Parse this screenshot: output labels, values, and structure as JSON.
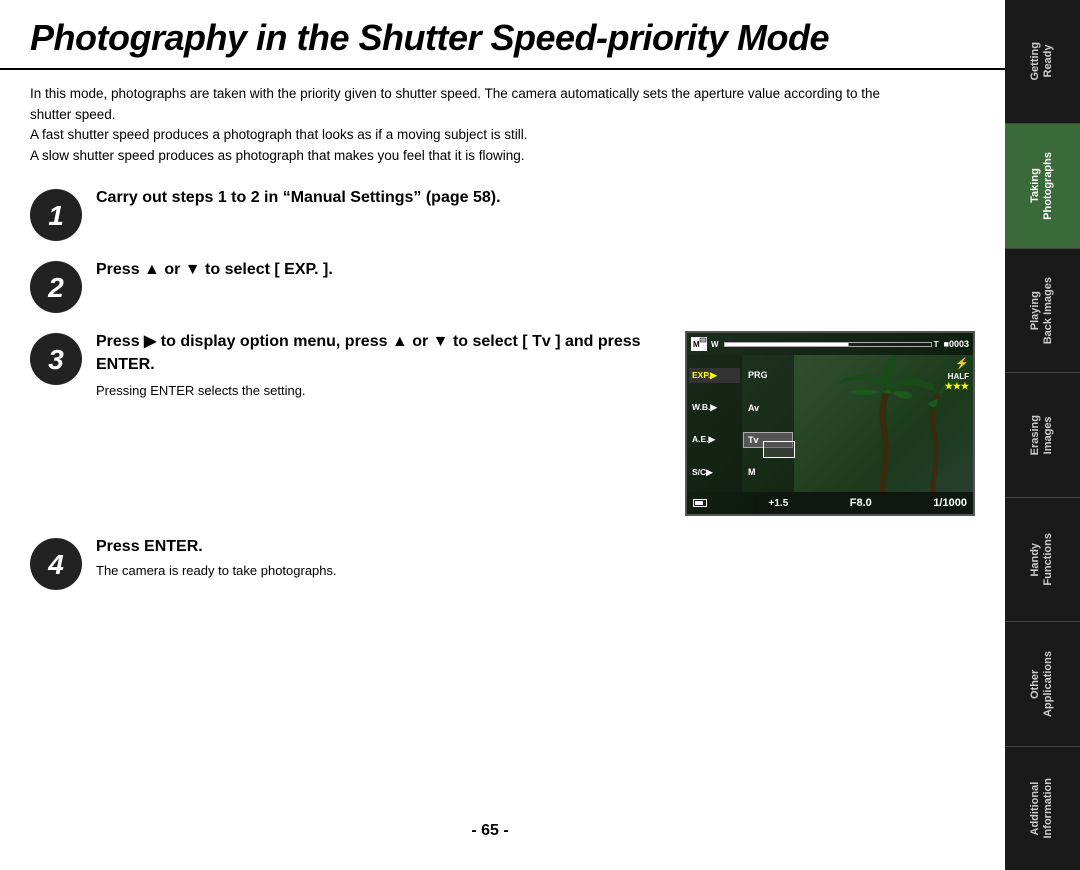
{
  "page": {
    "title": "Photography in the Shutter Speed-priority Mode",
    "intro": [
      "In this mode, photographs are taken with the priority given to shutter speed. The camera automatically sets the aperture value according to the shutter speed.",
      "A fast shutter speed produces a photograph that looks as if a moving subject is still.",
      "A slow shutter speed produces as photograph that makes you feel that it is flowing."
    ],
    "steps": [
      {
        "number": "1",
        "title": "Carry out steps 1 to 2 in “Manual Settings” (page 58).",
        "subtitle": ""
      },
      {
        "number": "2",
        "title": "Press ▲ or ▼ to select [ EXP. ].",
        "subtitle": ""
      },
      {
        "number": "3",
        "title": "Press ► to display option menu, press ▲ or ▼ to select  [ Tv ] and press ENTER.",
        "subtitle": "Pressing ENTER selects the setting."
      },
      {
        "number": "4",
        "title": "Press ENTER.",
        "subtitle": "The camera is ready to take photographs."
      }
    ],
    "lcd": {
      "mode": "M",
      "frame_count": "■0003",
      "exposure": "+1.5",
      "aperture": "F8.0",
      "shutter": "1/1000",
      "menu_items": [
        "EXP.►",
        "W.B.►",
        "A.E.►",
        "S/C►"
      ],
      "right_items": [
        "PRG",
        "Av",
        "Tv",
        "M"
      ],
      "flash": "⚡",
      "half_stars": "HALF ★★★"
    },
    "page_number": "- 65 -",
    "sidebar": {
      "tabs": [
        {
          "label": "Getting\nReady",
          "active": false
        },
        {
          "label": "Taking\nPhotographs",
          "active": true
        },
        {
          "label": "Playing\nBack Images",
          "active": false
        },
        {
          "label": "Erasing\nImages",
          "active": false
        },
        {
          "label": "Handy\nFunctions",
          "active": false
        },
        {
          "label": "Other\nApplications",
          "active": false
        },
        {
          "label": "Additional\nInformation",
          "active": false
        }
      ]
    }
  }
}
